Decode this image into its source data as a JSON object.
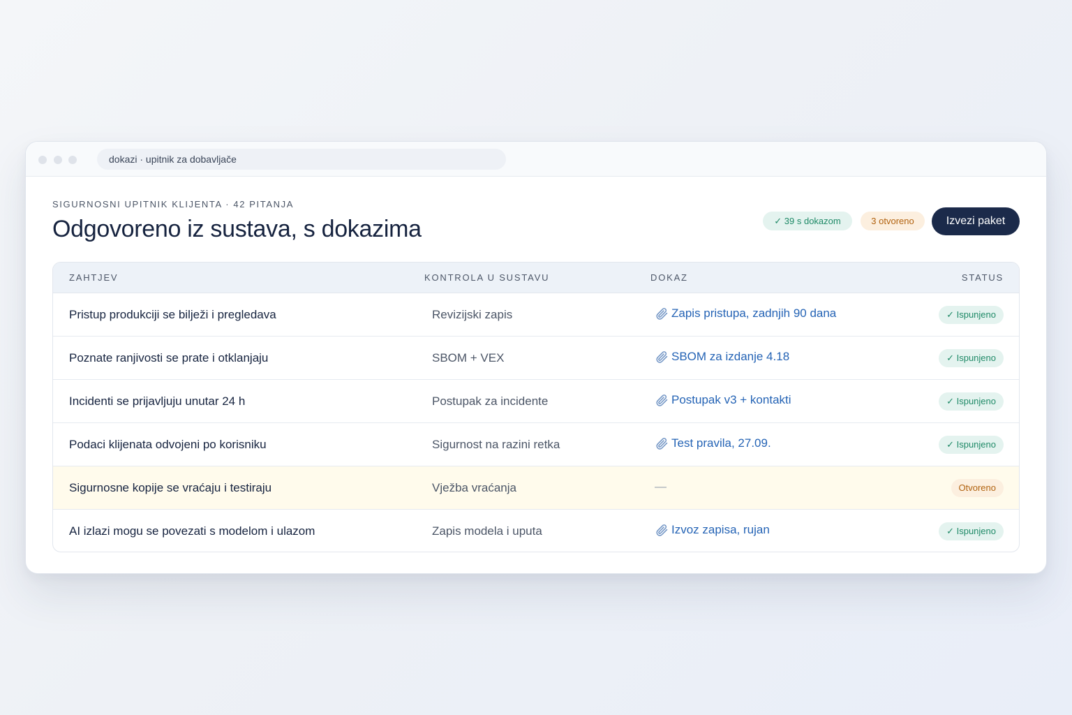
{
  "window": {
    "address": "dokazi · upitnik za dobavljače"
  },
  "header": {
    "eyebrow": "SIGURNOSNI UPITNIK KLIJENTA · 42 PITANJA",
    "title": "Odgovoreno iz sustava, s dokazima",
    "chip_evidence": "✓ 39 s dokazom",
    "chip_open": "3 otvoreno",
    "export_button": "Izvezi paket"
  },
  "table": {
    "columns": {
      "requirement": "ZAHTJEV",
      "control": "KONTROLA U SUSTAVU",
      "evidence": "DOKAZ",
      "status": "STATUS"
    },
    "rows": [
      {
        "requirement": "Pristup produkciji se bilježi i pregledava",
        "control": "Revizijski zapis",
        "evidence": "Zapis pristupa, zadnjih 90 dana",
        "status": "✓ Ispunjeno"
      },
      {
        "requirement": "Poznate ranjivosti se prate i otklanjaju",
        "control": "SBOM + VEX",
        "evidence": "SBOM za izdanje 4.18",
        "status": "✓ Ispunjeno"
      },
      {
        "requirement": "Incidenti se prijavljuju unutar 24 h",
        "control": "Postupak za incidente",
        "evidence": "Postupak v3 + kontakti",
        "status": "✓ Ispunjeno"
      },
      {
        "requirement": "Podaci klijenata odvojeni po korisniku",
        "control": "Sigurnost na razini retka",
        "evidence": "Test pravila, 27.09.",
        "status": "✓ Ispunjeno"
      },
      {
        "requirement": "Sigurnosne kopije se vraćaju i testiraju",
        "control": "Vježba vraćanja",
        "evidence": "—",
        "status": "Otvoreno"
      },
      {
        "requirement": "AI izlazi mogu se povezati s modelom i ulazom",
        "control": "Zapis modela i uputa",
        "evidence": "Izvoz zapisa, rujan",
        "status": "✓ Ispunjeno"
      }
    ]
  },
  "icons": {
    "evidence": "paperclip-icon"
  },
  "colors": {
    "accent": "#1b2a4a",
    "link": "#2463b5",
    "success": "#1f8a67",
    "warning": "#b1620f"
  }
}
